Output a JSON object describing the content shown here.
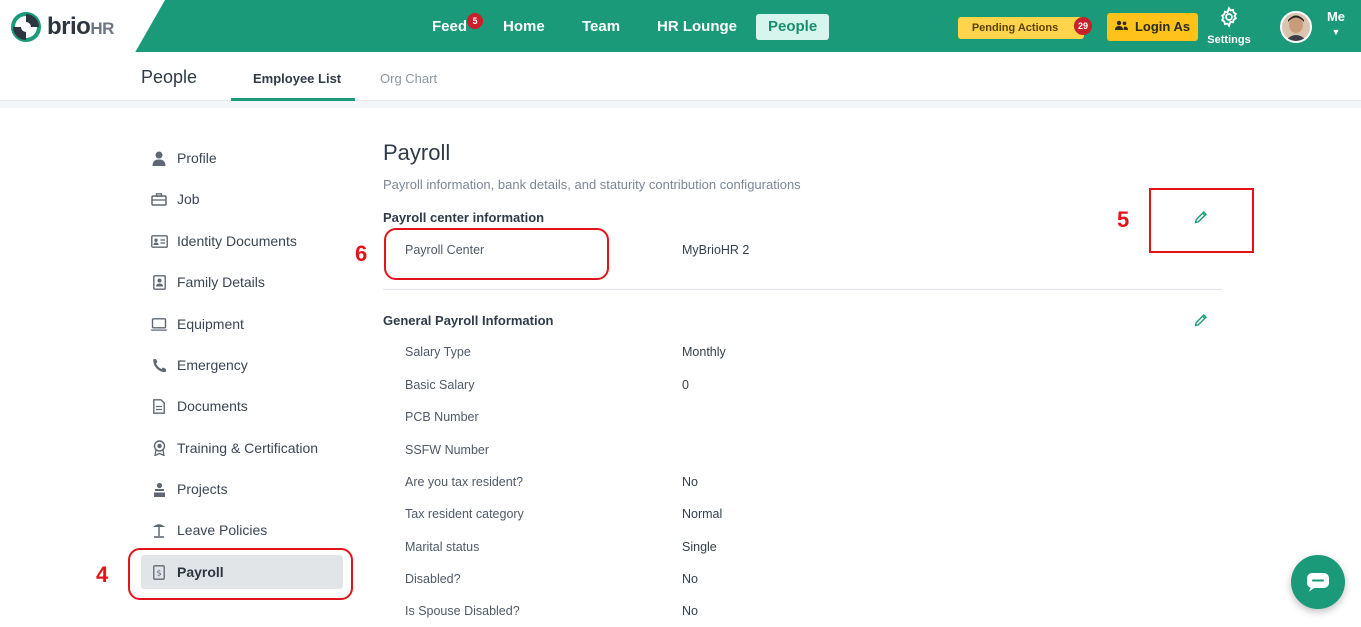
{
  "app": {
    "logo_brand": "brio",
    "logo_suffix": "HR"
  },
  "nav": {
    "feed": "Feed",
    "feed_badge": "5",
    "home": "Home",
    "team": "Team",
    "hr_lounge": "HR Lounge",
    "people": "People"
  },
  "header_actions": {
    "pending_actions": "Pending Actions",
    "pending_count": "29",
    "login_as": "Login As",
    "settings": "Settings",
    "me": "Me"
  },
  "subheader": {
    "page_title": "People",
    "tabs": [
      {
        "label": "Employee List",
        "active": true
      },
      {
        "label": "Org Chart",
        "active": false
      }
    ]
  },
  "sidebar": {
    "items": [
      {
        "label": "Profile",
        "icon": "user-icon"
      },
      {
        "label": "Job",
        "icon": "briefcase-icon"
      },
      {
        "label": "Identity Documents",
        "icon": "id-card-icon"
      },
      {
        "label": "Family Details",
        "icon": "family-icon"
      },
      {
        "label": "Equipment",
        "icon": "laptop-icon"
      },
      {
        "label": "Emergency",
        "icon": "phone-icon"
      },
      {
        "label": "Documents",
        "icon": "document-icon"
      },
      {
        "label": "Training & Certification",
        "icon": "award-icon"
      },
      {
        "label": "Projects",
        "icon": "project-icon"
      },
      {
        "label": "Leave Policies",
        "icon": "beach-icon"
      },
      {
        "label": "Payroll",
        "icon": "payroll-icon",
        "active": true
      }
    ]
  },
  "main": {
    "title": "Payroll",
    "subtitle": "Payroll information, bank details, and staturity contribution configurations",
    "payroll_center": {
      "title": "Payroll center information",
      "fields": [
        {
          "label": "Payroll Center",
          "value": "MyBrioHR 2"
        }
      ]
    },
    "general": {
      "title": "General Payroll Information",
      "fields": [
        {
          "label": "Salary Type",
          "value": "Monthly"
        },
        {
          "label": "Basic Salary",
          "value": "0"
        },
        {
          "label": "PCB Number",
          "value": ""
        },
        {
          "label": "SSFW Number",
          "value": ""
        },
        {
          "label": "Are you tax resident?",
          "value": "No"
        },
        {
          "label": "Tax resident category",
          "value": "Normal"
        },
        {
          "label": "Marital status",
          "value": "Single"
        },
        {
          "label": "Disabled?",
          "value": "No"
        },
        {
          "label": "Is Spouse Disabled?",
          "value": "No"
        }
      ]
    }
  },
  "annotations": {
    "n4": "4",
    "n5": "5",
    "n6": "6"
  },
  "colors": {
    "brand_green": "#1a9a78",
    "annotation_red": "#e3131b",
    "pending_yellow": "#fdd44a",
    "login_yellow": "#ffc21a",
    "badge_red": "#c9202b"
  }
}
